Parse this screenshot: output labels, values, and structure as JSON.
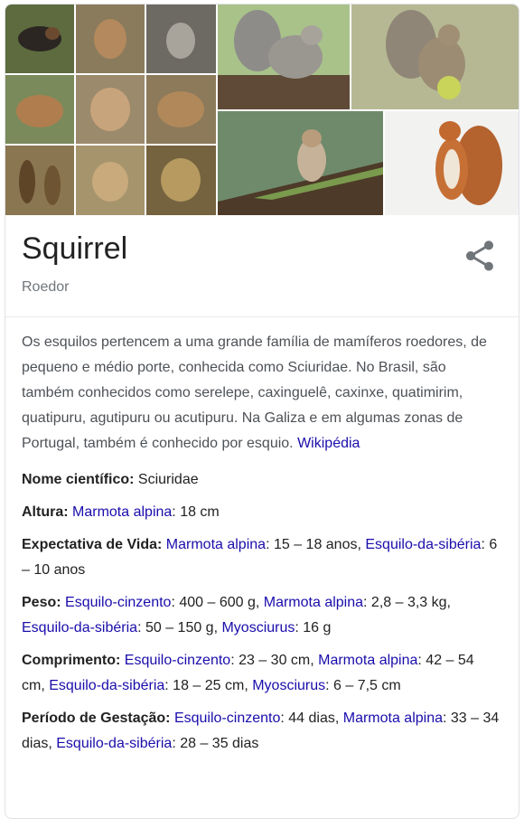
{
  "entity": {
    "title": "Squirrel",
    "subtitle": "Roedor"
  },
  "icons": {
    "share": "share-icon"
  },
  "colors": {
    "link": "#1a0dab",
    "title": "#222222",
    "subtitle": "#70757a",
    "text": "#4d5156",
    "border": "#dfe1e5"
  },
  "description": {
    "text": "Os esquilos pertencem a uma grande família de mamíferos roedores, de pequeno e médio porte, conhecida como Sciuridae. No Brasil, são também conhecidos como serelepe, caxinguelê, caxinxe, quatimirim, quatipuru, agutipuru ou acutipuru. Na Galiza e em algumas zonas de Portugal, também é conhecido por esquio.",
    "source_link": "Wikipédia"
  },
  "facts": [
    {
      "label": "Nome científico:",
      "parts": [
        {
          "t": "Sciuridae",
          "link": false
        }
      ]
    },
    {
      "label": "Altura:",
      "parts": [
        {
          "t": "Marmota alpina",
          "link": true
        },
        {
          "t": ": 18 cm",
          "link": false
        }
      ]
    },
    {
      "label": "Expectativa de Vida:",
      "parts": [
        {
          "t": "Marmota alpina",
          "link": true
        },
        {
          "t": ": 15 – 18 anos, ",
          "link": false
        },
        {
          "t": "Esquilo-da-sibéria",
          "link": true
        },
        {
          "t": ": 6 – 10 anos",
          "link": false
        }
      ]
    },
    {
      "label": "Peso:",
      "parts": [
        {
          "t": "Esquilo-cinzento",
          "link": true
        },
        {
          "t": ": 400 – 600 g, ",
          "link": false
        },
        {
          "t": "Marmota alpina",
          "link": true
        },
        {
          "t": ": 2,8 – 3,3 kg, ",
          "link": false
        },
        {
          "t": "Esquilo-da-sibéria",
          "link": true
        },
        {
          "t": ": 50 – 150 g, ",
          "link": false
        },
        {
          "t": "Myosciurus",
          "link": true
        },
        {
          "t": ": 16 g",
          "link": false
        }
      ]
    },
    {
      "label": "Comprimento:",
      "parts": [
        {
          "t": "Esquilo-cinzento",
          "link": true
        },
        {
          "t": ": 23 – 30 cm, ",
          "link": false
        },
        {
          "t": "Marmota alpina",
          "link": true
        },
        {
          "t": ": 42 – 54 cm, ",
          "link": false
        },
        {
          "t": "Esquilo-da-sibéria",
          "link": true
        },
        {
          "t": ": 18 – 25 cm, ",
          "link": false
        },
        {
          "t": "Myosciurus",
          "link": true
        },
        {
          "t": ": 6 – 7,5 cm",
          "link": false
        }
      ]
    },
    {
      "label": "Período de Gestação:",
      "parts": [
        {
          "t": "Esquilo-cinzento",
          "link": true
        },
        {
          "t": ": 44 dias, ",
          "link": false
        },
        {
          "t": "Marmota alpina",
          "link": true
        },
        {
          "t": ": 33 – 34 dias, ",
          "link": false
        },
        {
          "t": "Esquilo-da-sibéria",
          "link": true
        },
        {
          "t": ": 28 – 35 dias",
          "link": false
        }
      ]
    }
  ]
}
